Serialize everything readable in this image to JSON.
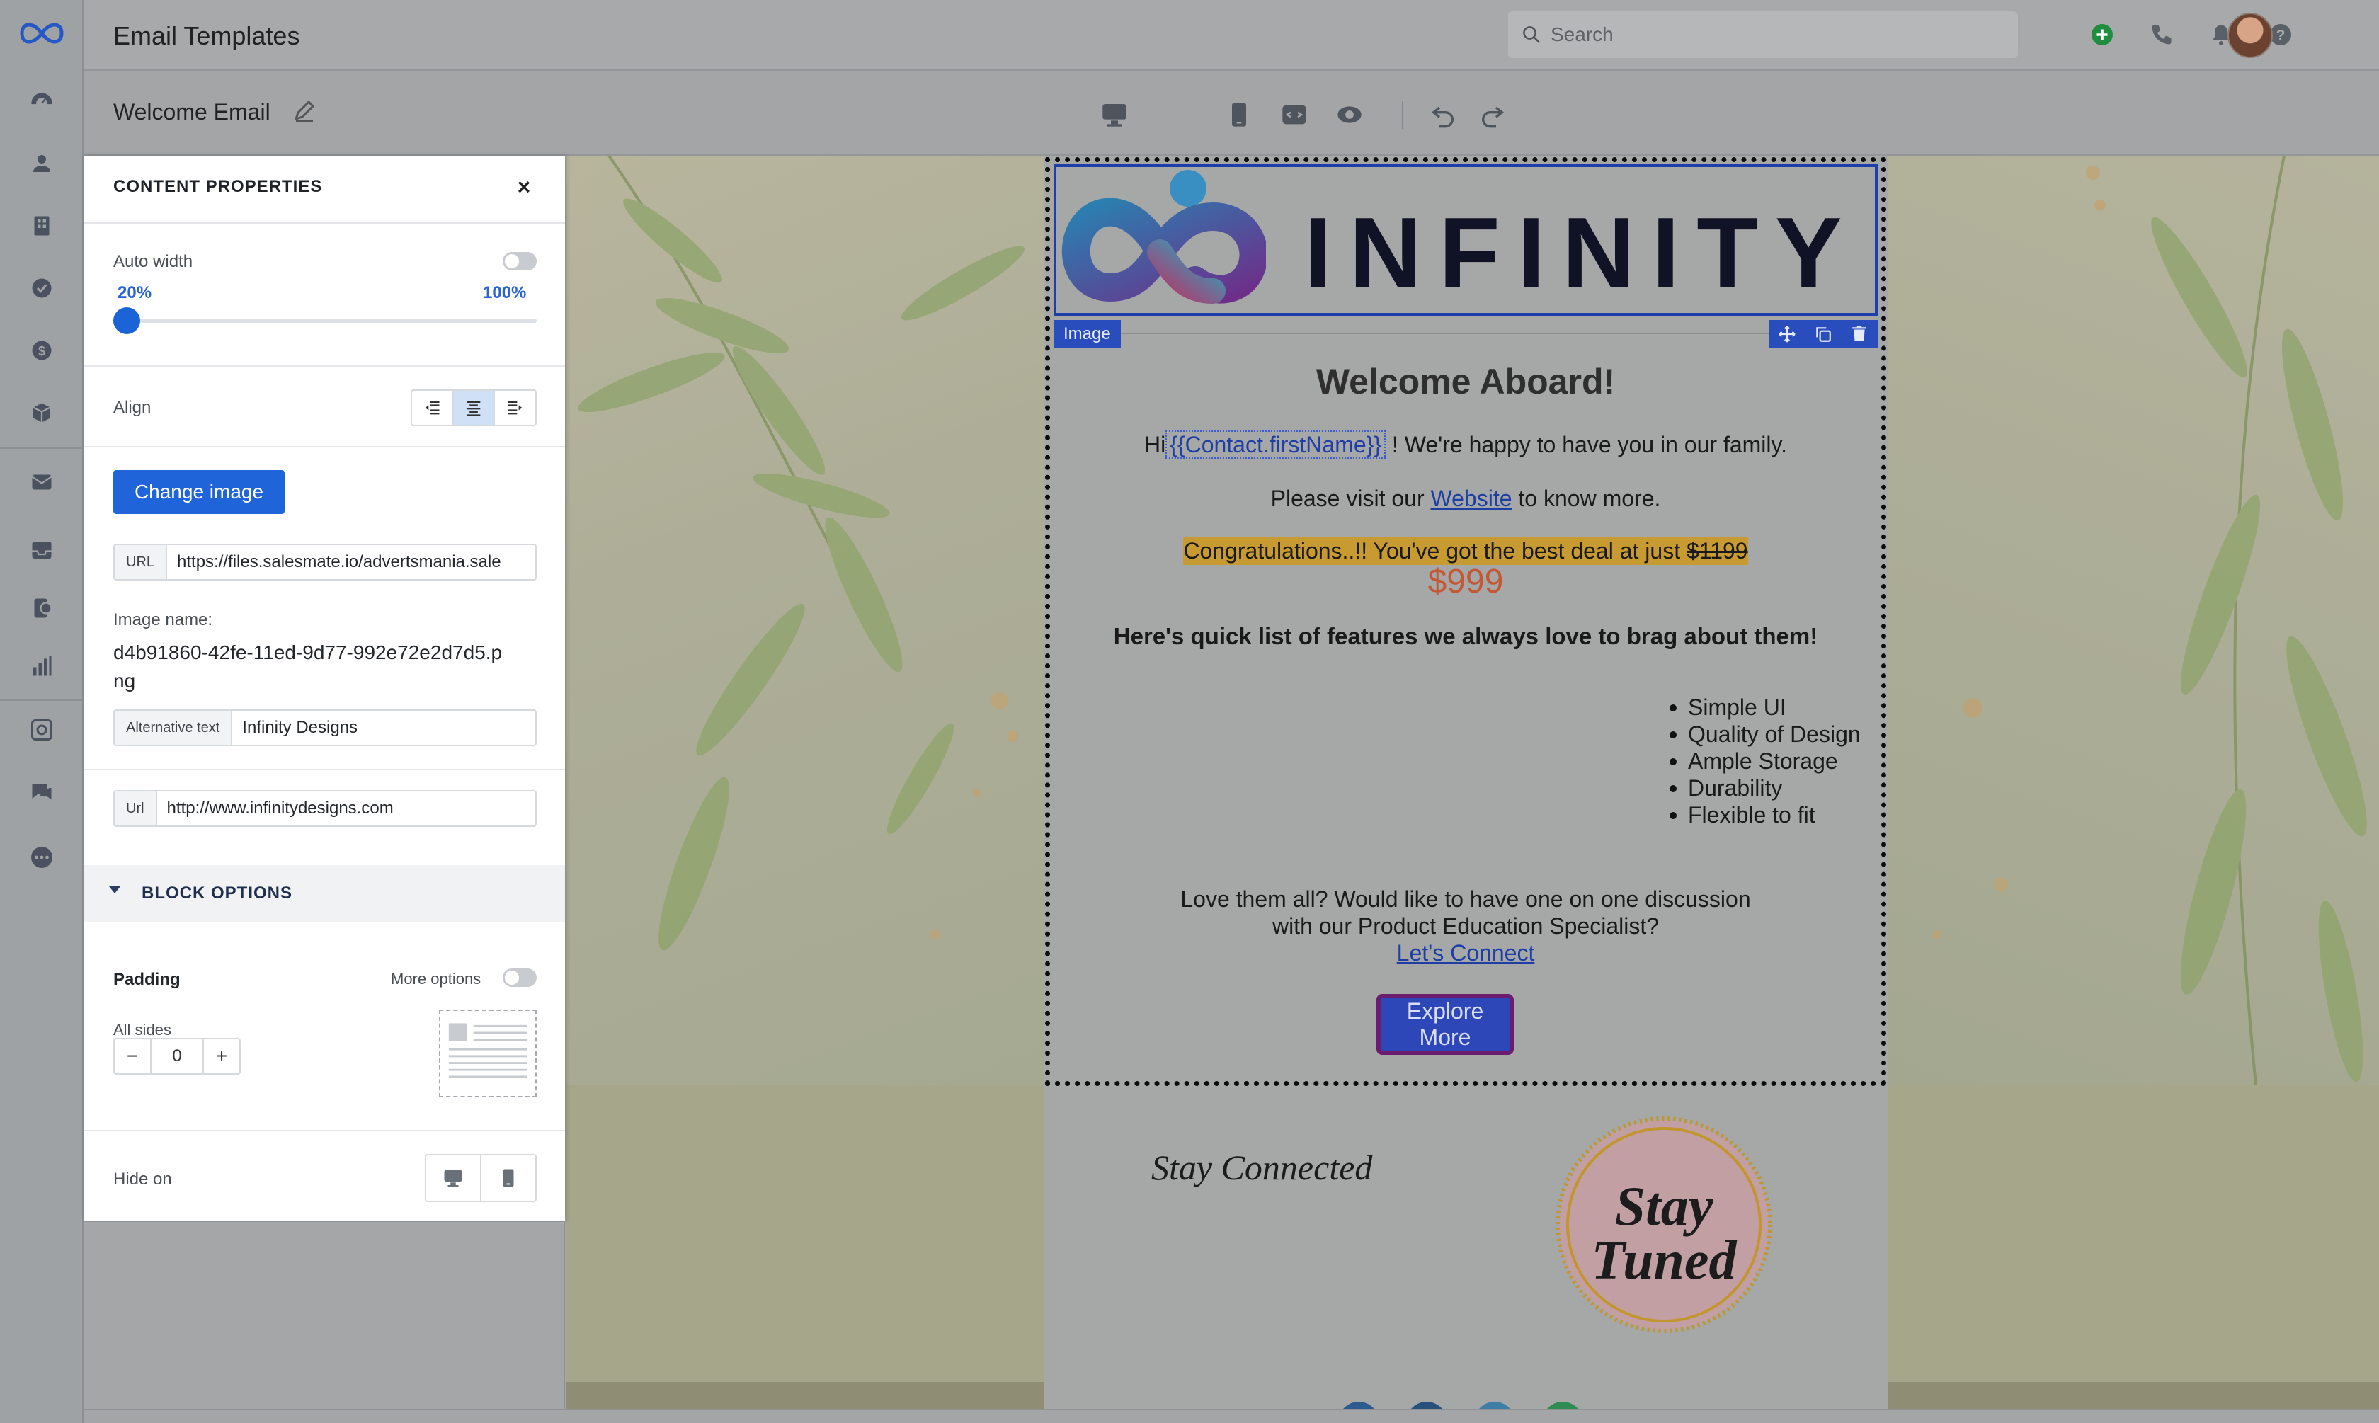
{
  "header": {
    "title": "Email Templates",
    "search_placeholder": "Search"
  },
  "subheader": {
    "template_name": "Welcome Email"
  },
  "sidebar": {
    "icons": [
      "infinity-logo-icon",
      "dashboard-icon",
      "contacts-icon",
      "companies-icon",
      "tasks-icon",
      "deals-icon",
      "products-icon",
      "email-icon",
      "inbox-icon",
      "sequences-icon",
      "reports-icon",
      "automation-icon",
      "chat-icon",
      "more-icon"
    ]
  },
  "toolbar": {
    "icons": [
      "desktop-view-icon",
      "mobile-view-icon",
      "code-view-icon",
      "preview-icon",
      "undo-icon",
      "redo-icon"
    ]
  },
  "panel": {
    "title": "CONTENT PROPERTIES",
    "close": "×",
    "auto_width_label": "Auto width",
    "range_min": "20%",
    "range_max": "100%",
    "width_fraction": 0.0,
    "align_label": "Align",
    "change_image_label": "Change image",
    "url_tag": "URL",
    "url_value": "https://files.salesmate.io/advertsmania.sale",
    "image_name_label": "Image name:",
    "image_name_value": "d4b91860-42fe-11ed-9d77-992e72e2d7d5.png",
    "alt_tag": "Alternative text",
    "alt_value": "Infinity Designs",
    "link_tag": "Url",
    "link_value": "http://www.infinitydesigns.com",
    "block_options": "BLOCK OPTIONS",
    "padding_label": "Padding",
    "more_options_label": "More options",
    "all_sides_label": "All sides",
    "padding_value": "0",
    "stepper_minus": "−",
    "stepper_plus": "+",
    "hide_on_label": "Hide on"
  },
  "email": {
    "logo_text": "INFINITY",
    "image_tag": "Image",
    "heading": "Welcome Aboard!",
    "greeting_prefix": "Hi",
    "merge_tag": "{{Contact.firstName}}",
    "greeting_suffix": " ! We're happy to have you in our family.",
    "visit_prefix": "Please visit our ",
    "visit_link": "Website",
    "visit_suffix": " to know more.",
    "deal_text": "Congratulations..!! You've got the best deal at just ",
    "deal_old_price": "$1199",
    "deal_new_price": "$999",
    "features_heading": "Here's quick list of features we always love to brag about them!",
    "features": [
      "Simple UI",
      "Quality of Design",
      "Ample Storage",
      "Durability",
      "Flexible to fit"
    ],
    "love_line1": "Love them all? Would like to have one on one discussion",
    "love_line2": "with our Product Education Specialist?",
    "connect_link": "Let's Connect",
    "cta_label": "Explore More",
    "stay_connected": "Stay Connected",
    "stay_tuned_line1": "Stay",
    "stay_tuned_line2": "Tuned"
  },
  "colors": {
    "accent": "#1f64d8",
    "selection": "#2a4dbd",
    "cta_border": "#6b1c6f",
    "price": "#c45834",
    "highlight": "#c89b32"
  }
}
